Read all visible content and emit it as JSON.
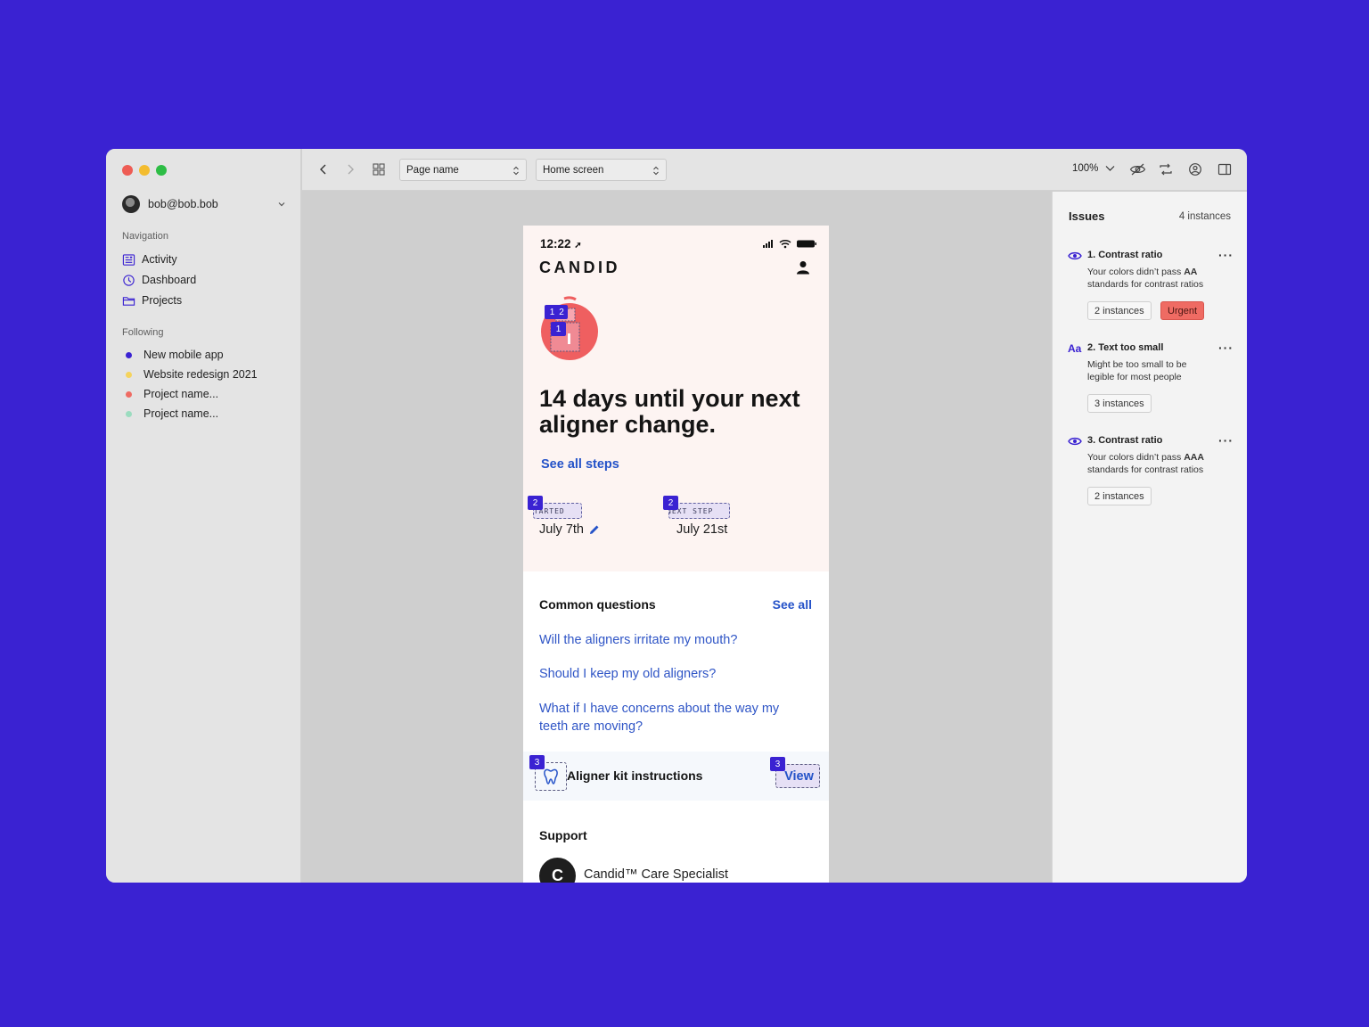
{
  "window": {
    "traffic_colors": [
      "#ee5c54",
      "#f3bc2f",
      "#2dbd45"
    ]
  },
  "sidebar": {
    "user": "bob@bob.bob",
    "navigation_label": "Navigation",
    "navigation": [
      {
        "label": "Activity",
        "icon": "newspaper-icon"
      },
      {
        "label": "Dashboard",
        "icon": "clock-icon"
      },
      {
        "label": "Projects",
        "icon": "folder-icon"
      }
    ],
    "following_label": "Following",
    "following": [
      {
        "label": "New mobile app",
        "color": "#3a22d2"
      },
      {
        "label": "Website redesign 2021",
        "color": "#f5d35c"
      },
      {
        "label": "Project name...",
        "color": "#ef6b63"
      },
      {
        "label": "Project name...",
        "color": "#9bdcbf"
      }
    ]
  },
  "toolbar": {
    "page_select": "Page name",
    "screen_select": "Home screen",
    "zoom": "100%"
  },
  "phone": {
    "status_time": "12:22",
    "logo": "CANDID",
    "headline": "14 days until your next aligner change.",
    "see_all_steps": "See all steps",
    "steps": [
      {
        "tag": "STARTED",
        "date": "July 7th",
        "marker": "2"
      },
      {
        "tag": "NEXT STEP",
        "date": "July 21st",
        "marker": "2"
      }
    ],
    "badge_markers": [
      "1",
      "2",
      "1"
    ],
    "common_questions_title": "Common questions",
    "common_questions_see_all": "See all",
    "questions": [
      "Will the aligners irritate my mouth?",
      "Should I keep my old aligners?",
      "What if I have concerns about the way my teeth are moving?"
    ],
    "kit": {
      "label": "Aligner kit instructions",
      "action": "View",
      "marker": "3"
    },
    "support_title": "Support",
    "care_specialist": "Candid™ Care Specialist",
    "care_avatar_text": "C"
  },
  "issues": {
    "title": "Issues",
    "count": "4 instances",
    "items": [
      {
        "title": "1. Contrast ratio",
        "desc_pre": "Your colors didn’t pass ",
        "desc_bold": "AA",
        "desc_post": " standards for contrast ratios",
        "chip": "2 instances",
        "urgent": "Urgent",
        "icon": "eye-icon"
      },
      {
        "title": "2. Text too small",
        "desc_pre": "Might be too small to be legible for most people",
        "desc_bold": "",
        "desc_post": "",
        "chip": "3 instances",
        "icon": "text-size-icon",
        "icon_text": "Aa"
      },
      {
        "title": "3. Contrast ratio",
        "desc_pre": "Your colors didn’t pass ",
        "desc_bold": "AAA",
        "desc_post": " standards for contrast ratios",
        "chip": "2 instances",
        "icon": "eye-icon"
      }
    ]
  },
  "colors": {
    "background": "#3a22d2",
    "link": "#2452c8",
    "marker": "#3a22d2",
    "urgent": "#ef6b63",
    "hero": "#fdf4f2"
  }
}
